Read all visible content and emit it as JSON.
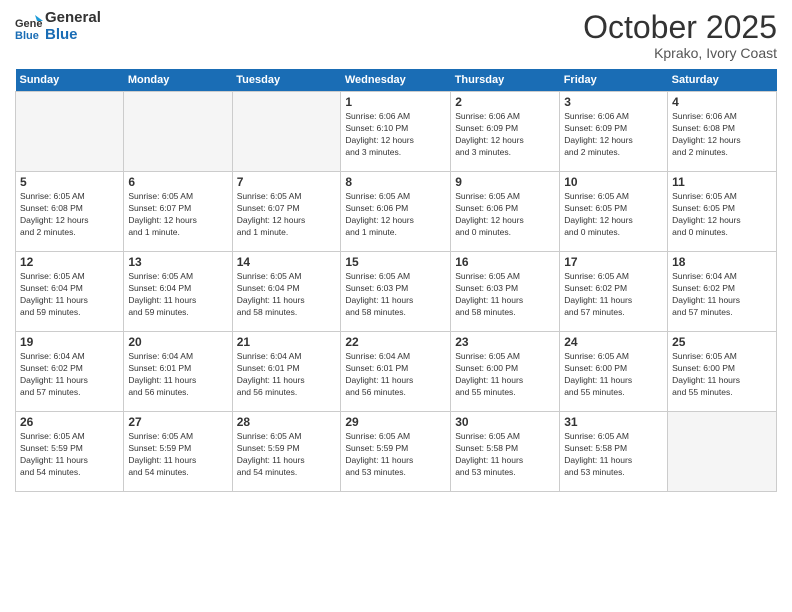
{
  "logo": {
    "line1": "General",
    "line2": "Blue"
  },
  "title": "October 2025",
  "location": "Kprako, Ivory Coast",
  "days_of_week": [
    "Sunday",
    "Monday",
    "Tuesday",
    "Wednesday",
    "Thursday",
    "Friday",
    "Saturday"
  ],
  "weeks": [
    [
      {
        "day": "",
        "info": ""
      },
      {
        "day": "",
        "info": ""
      },
      {
        "day": "",
        "info": ""
      },
      {
        "day": "1",
        "info": "Sunrise: 6:06 AM\nSunset: 6:10 PM\nDaylight: 12 hours\nand 3 minutes."
      },
      {
        "day": "2",
        "info": "Sunrise: 6:06 AM\nSunset: 6:09 PM\nDaylight: 12 hours\nand 3 minutes."
      },
      {
        "day": "3",
        "info": "Sunrise: 6:06 AM\nSunset: 6:09 PM\nDaylight: 12 hours\nand 2 minutes."
      },
      {
        "day": "4",
        "info": "Sunrise: 6:06 AM\nSunset: 6:08 PM\nDaylight: 12 hours\nand 2 minutes."
      }
    ],
    [
      {
        "day": "5",
        "info": "Sunrise: 6:05 AM\nSunset: 6:08 PM\nDaylight: 12 hours\nand 2 minutes."
      },
      {
        "day": "6",
        "info": "Sunrise: 6:05 AM\nSunset: 6:07 PM\nDaylight: 12 hours\nand 1 minute."
      },
      {
        "day": "7",
        "info": "Sunrise: 6:05 AM\nSunset: 6:07 PM\nDaylight: 12 hours\nand 1 minute."
      },
      {
        "day": "8",
        "info": "Sunrise: 6:05 AM\nSunset: 6:06 PM\nDaylight: 12 hours\nand 1 minute."
      },
      {
        "day": "9",
        "info": "Sunrise: 6:05 AM\nSunset: 6:06 PM\nDaylight: 12 hours\nand 0 minutes."
      },
      {
        "day": "10",
        "info": "Sunrise: 6:05 AM\nSunset: 6:05 PM\nDaylight: 12 hours\nand 0 minutes."
      },
      {
        "day": "11",
        "info": "Sunrise: 6:05 AM\nSunset: 6:05 PM\nDaylight: 12 hours\nand 0 minutes."
      }
    ],
    [
      {
        "day": "12",
        "info": "Sunrise: 6:05 AM\nSunset: 6:04 PM\nDaylight: 11 hours\nand 59 minutes."
      },
      {
        "day": "13",
        "info": "Sunrise: 6:05 AM\nSunset: 6:04 PM\nDaylight: 11 hours\nand 59 minutes."
      },
      {
        "day": "14",
        "info": "Sunrise: 6:05 AM\nSunset: 6:04 PM\nDaylight: 11 hours\nand 58 minutes."
      },
      {
        "day": "15",
        "info": "Sunrise: 6:05 AM\nSunset: 6:03 PM\nDaylight: 11 hours\nand 58 minutes."
      },
      {
        "day": "16",
        "info": "Sunrise: 6:05 AM\nSunset: 6:03 PM\nDaylight: 11 hours\nand 58 minutes."
      },
      {
        "day": "17",
        "info": "Sunrise: 6:05 AM\nSunset: 6:02 PM\nDaylight: 11 hours\nand 57 minutes."
      },
      {
        "day": "18",
        "info": "Sunrise: 6:04 AM\nSunset: 6:02 PM\nDaylight: 11 hours\nand 57 minutes."
      }
    ],
    [
      {
        "day": "19",
        "info": "Sunrise: 6:04 AM\nSunset: 6:02 PM\nDaylight: 11 hours\nand 57 minutes."
      },
      {
        "day": "20",
        "info": "Sunrise: 6:04 AM\nSunset: 6:01 PM\nDaylight: 11 hours\nand 56 minutes."
      },
      {
        "day": "21",
        "info": "Sunrise: 6:04 AM\nSunset: 6:01 PM\nDaylight: 11 hours\nand 56 minutes."
      },
      {
        "day": "22",
        "info": "Sunrise: 6:04 AM\nSunset: 6:01 PM\nDaylight: 11 hours\nand 56 minutes."
      },
      {
        "day": "23",
        "info": "Sunrise: 6:05 AM\nSunset: 6:00 PM\nDaylight: 11 hours\nand 55 minutes."
      },
      {
        "day": "24",
        "info": "Sunrise: 6:05 AM\nSunset: 6:00 PM\nDaylight: 11 hours\nand 55 minutes."
      },
      {
        "day": "25",
        "info": "Sunrise: 6:05 AM\nSunset: 6:00 PM\nDaylight: 11 hours\nand 55 minutes."
      }
    ],
    [
      {
        "day": "26",
        "info": "Sunrise: 6:05 AM\nSunset: 5:59 PM\nDaylight: 11 hours\nand 54 minutes."
      },
      {
        "day": "27",
        "info": "Sunrise: 6:05 AM\nSunset: 5:59 PM\nDaylight: 11 hours\nand 54 minutes."
      },
      {
        "day": "28",
        "info": "Sunrise: 6:05 AM\nSunset: 5:59 PM\nDaylight: 11 hours\nand 54 minutes."
      },
      {
        "day": "29",
        "info": "Sunrise: 6:05 AM\nSunset: 5:59 PM\nDaylight: 11 hours\nand 53 minutes."
      },
      {
        "day": "30",
        "info": "Sunrise: 6:05 AM\nSunset: 5:58 PM\nDaylight: 11 hours\nand 53 minutes."
      },
      {
        "day": "31",
        "info": "Sunrise: 6:05 AM\nSunset: 5:58 PM\nDaylight: 11 hours\nand 53 minutes."
      },
      {
        "day": "",
        "info": ""
      }
    ]
  ]
}
